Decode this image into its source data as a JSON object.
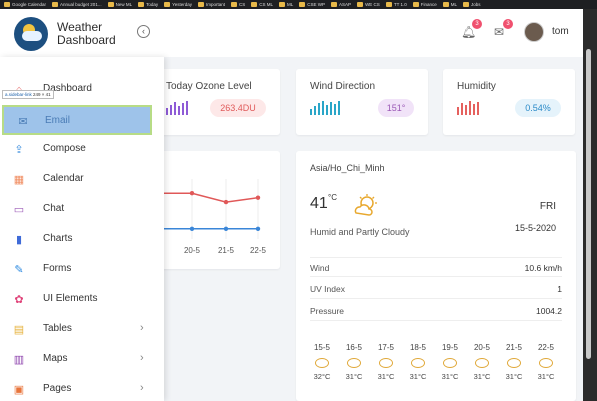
{
  "bookmarks": [
    "Google Calendar",
    "Annual budget 201...",
    "New ML",
    "Today",
    "Yesterday",
    "Important",
    "CS",
    "CS ML",
    "ML",
    "CSE WP",
    "ASAP",
    "WE CS",
    "TT 1.0",
    "Finance",
    "ML",
    "Jobs"
  ],
  "header": {
    "title": "Weather Dashboard",
    "notifications_count": "3",
    "messages_count": "3",
    "username": "tom"
  },
  "sidebar": {
    "tooltip_selector": "a.sidebar-link",
    "tooltip_size": "249 × 41",
    "items": [
      {
        "label": "Dashboard",
        "icon": "dashboard-icon",
        "color": "#e56b6b"
      },
      {
        "label": "Email",
        "icon": "envelope-icon",
        "color": "#4a7cb5"
      },
      {
        "label": "Compose",
        "icon": "share-icon",
        "color": "#3a8dde"
      },
      {
        "label": "Calendar",
        "icon": "calendar-icon",
        "color": "#f08a5d"
      },
      {
        "label": "Chat",
        "icon": "chat-icon",
        "color": "#9b59b6"
      },
      {
        "label": "Charts",
        "icon": "bar-chart-icon",
        "color": "#3f6bd8"
      },
      {
        "label": "Forms",
        "icon": "pencil-icon",
        "color": "#2d8ae0"
      },
      {
        "label": "UI Elements",
        "icon": "palette-icon",
        "color": "#e0457b"
      },
      {
        "label": "Tables",
        "icon": "table-icon",
        "color": "#e6b13a"
      },
      {
        "label": "Maps",
        "icon": "map-icon",
        "color": "#8e44ad"
      },
      {
        "label": "Pages",
        "icon": "pages-icon",
        "color": "#e8743b"
      }
    ]
  },
  "cards": {
    "ozone": {
      "title": "Today Ozone Level",
      "value": "263.4DU",
      "accent": "#8e5bd6"
    },
    "wind": {
      "title": "Wind Direction",
      "value": "151°",
      "accent": "#2aa6c8"
    },
    "humidity": {
      "title": "Humidity",
      "value": "0.54%",
      "accent": "#e5615e"
    }
  },
  "chart_data": {
    "type": "line",
    "categories": [
      "20-5",
      "21-5",
      "22-5"
    ],
    "series": [
      {
        "values": [
          33,
          31,
          32
        ],
        "color": "#e05858"
      },
      {
        "values": [
          25,
          25,
          25
        ],
        "color": "#3a86d8"
      }
    ],
    "xlabel": "",
    "ylabel": "",
    "grid": true
  },
  "weather": {
    "location": "Asia/Ho_Chi_Minh",
    "temperature": "41",
    "unit": "°C",
    "day": "FRI",
    "description": "Humid and Partly Cloudy",
    "date": "15-5-2020",
    "details": [
      {
        "label": "Wind",
        "value": "10.6 km/h"
      },
      {
        "label": "UV Index",
        "value": "1"
      },
      {
        "label": "Pressure",
        "value": "1004.2"
      }
    ],
    "forecast": [
      {
        "date": "15-5",
        "temp": "32°C"
      },
      {
        "date": "16-5",
        "temp": "31°C"
      },
      {
        "date": "17-5",
        "temp": "31°C"
      },
      {
        "date": "18-5",
        "temp": "31°C"
      },
      {
        "date": "19-5",
        "temp": "31°C"
      },
      {
        "date": "20-5",
        "temp": "31°C"
      },
      {
        "date": "21-5",
        "temp": "31°C"
      },
      {
        "date": "22-5",
        "temp": "31°C"
      }
    ]
  }
}
